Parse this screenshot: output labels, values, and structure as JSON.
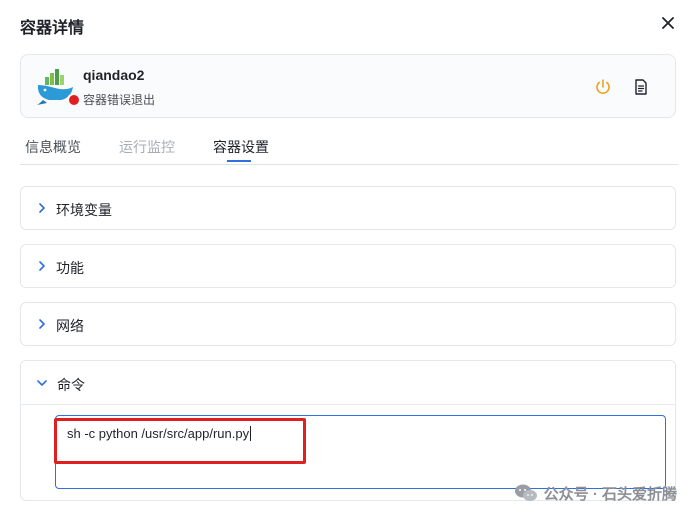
{
  "dialog": {
    "title": "容器详情",
    "close_icon": "close-icon"
  },
  "container": {
    "name": "qiandao2",
    "status_text": "容器错误退出",
    "status_color": "#e02020",
    "accent_power": "#f0a020"
  },
  "tabs": [
    {
      "label": "信息概览",
      "active": false,
      "disabled": false
    },
    {
      "label": "运行监控",
      "active": false,
      "disabled": true
    },
    {
      "label": "容器设置",
      "active": true,
      "disabled": false
    }
  ],
  "sections": [
    {
      "label": "环境变量",
      "expanded": false
    },
    {
      "label": "功能",
      "expanded": false
    },
    {
      "label": "网络",
      "expanded": false
    },
    {
      "label": "命令",
      "expanded": true
    }
  ],
  "command": {
    "value": "sh -c python /usr/src/app/run.py"
  },
  "watermark": {
    "text": "公众号 · 石头爱折腾"
  },
  "colors": {
    "primary": "#2f6fde",
    "highlight": "#e02020"
  }
}
